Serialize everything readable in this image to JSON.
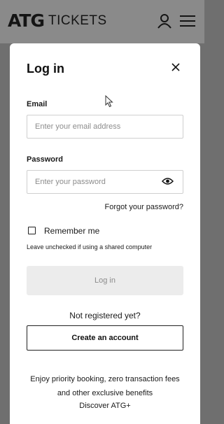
{
  "header": {
    "logo_mark": "ATG",
    "logo_text": "TICKETS",
    "account_icon": "user-icon",
    "menu_icon": "hamburger-menu-icon"
  },
  "modal": {
    "title": "Log in",
    "close_icon": "close-icon",
    "email": {
      "label": "Email",
      "placeholder": "Enter your email address",
      "value": ""
    },
    "password": {
      "label": "Password",
      "placeholder": "Enter your password",
      "value": "",
      "toggle_icon": "eye-icon"
    },
    "forgot_link": "Forgot your password?",
    "remember": {
      "label": "Remember me",
      "checked": false,
      "helper": "Leave unchecked if using a shared computer"
    },
    "login_button": "Log in",
    "not_registered": "Not registered yet?",
    "create_account_button": "Create an account",
    "promo_text": "Enjoy priority booking, zero transaction fees and other exclusive benefits",
    "discover_link": "Discover ATG+"
  },
  "colors": {
    "overlay": "#6f6f6f",
    "header_bg": "#8a8a8a",
    "modal_bg": "#ffffff",
    "disabled_button_bg": "#ececec"
  }
}
